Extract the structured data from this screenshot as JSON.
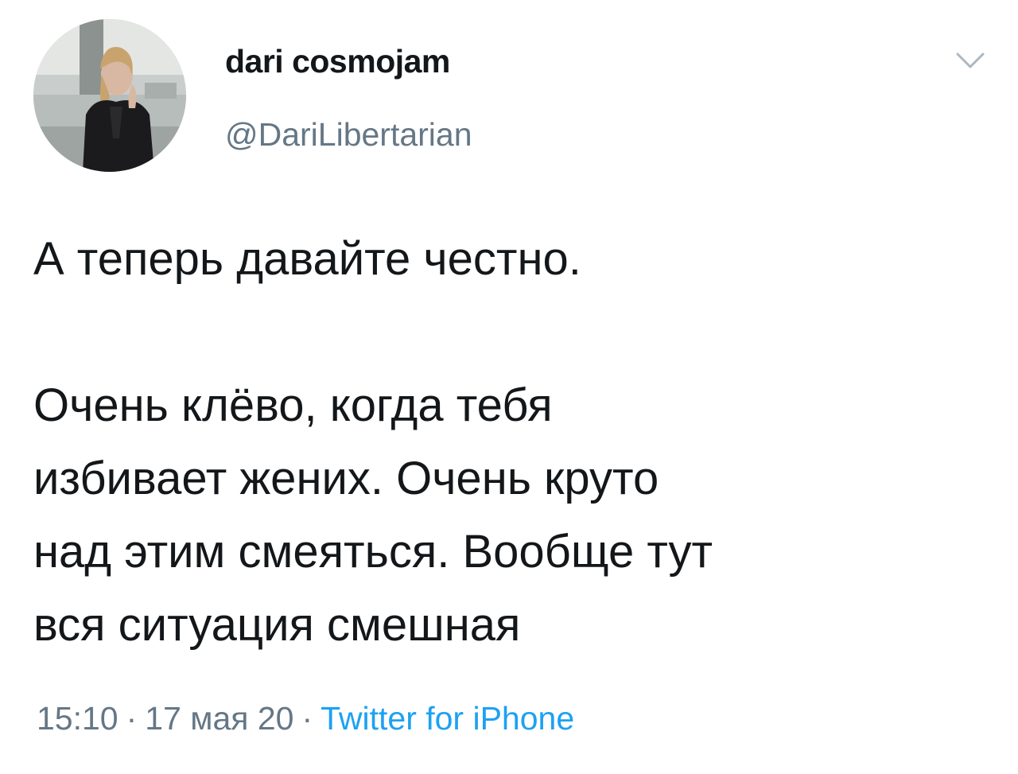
{
  "author": {
    "display_name": "dari cosmojam",
    "handle": "@DariLibertarian",
    "avatar_icon": "profile-photo"
  },
  "menu": {
    "icon": "chevron-down-icon"
  },
  "tweet": {
    "paragraph_1": "А теперь давайте честно.",
    "paragraph_2": "Очень клёво, когда тебя\nизбивает жених. Очень круто\nнад этим смеяться. Вообще тут\nвся ситуация смешная"
  },
  "meta": {
    "time": "15:10",
    "separator": "·",
    "date": "17 мая 20",
    "source": "Twitter for iPhone"
  },
  "colors": {
    "text": "#14171a",
    "secondary": "#657786",
    "link": "#1da1f2",
    "background": "#ffffff"
  }
}
